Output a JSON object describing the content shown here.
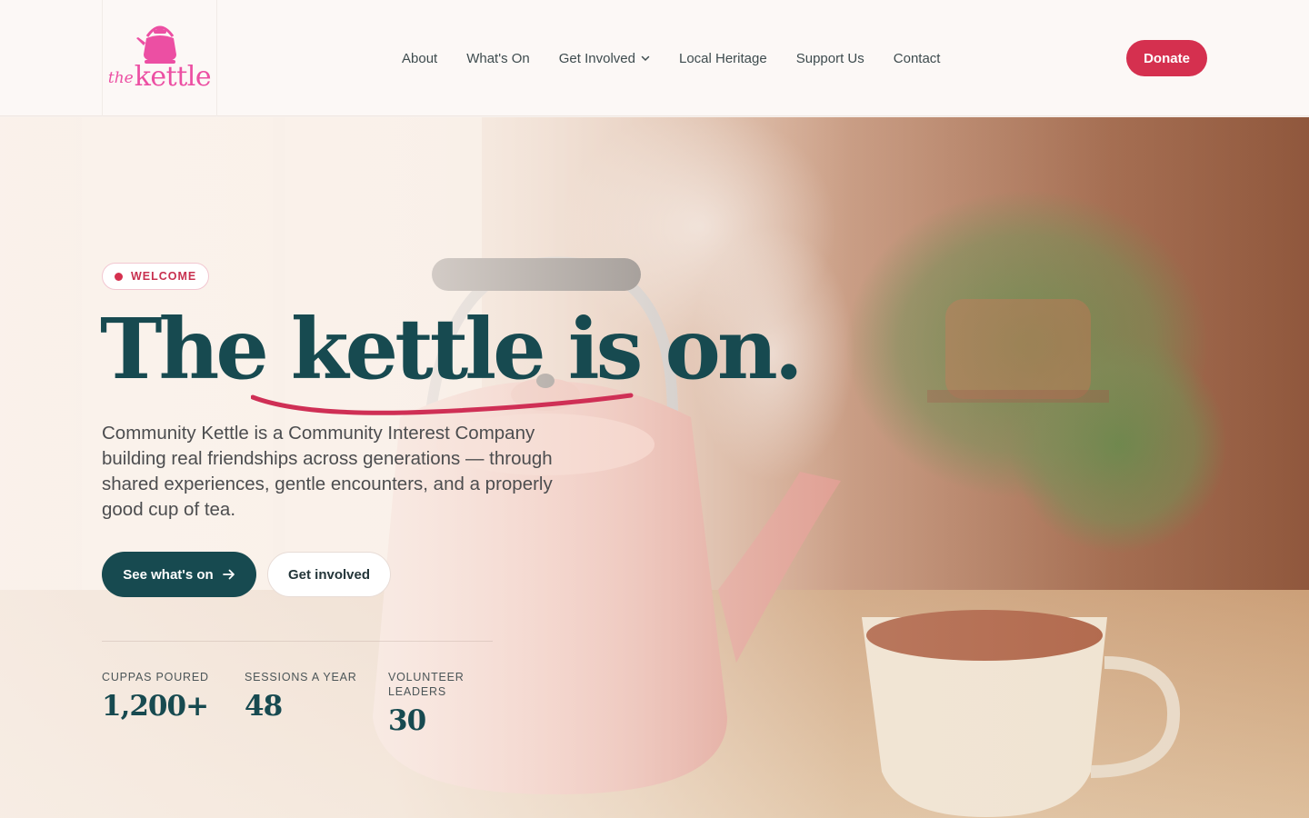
{
  "brand": {
    "logo_prefix": "the",
    "logo_word": "kettle",
    "color_primary": "#174a50",
    "color_accent": "#d5304f",
    "color_logo": "#ec4fa3"
  },
  "nav": {
    "items": [
      {
        "label": "About"
      },
      {
        "label": "What's On"
      },
      {
        "label": "Get Involved",
        "has_dropdown": true
      },
      {
        "label": "Local Heritage"
      },
      {
        "label": "Support Us"
      },
      {
        "label": "Contact"
      }
    ],
    "donate_label": "Donate"
  },
  "hero": {
    "badge": "WELCOME",
    "title_the": "The ",
    "title_rest": "kettle is on.",
    "description": "Community Kettle is a Community Interest Company building real friendships across generations — through shared experiences, gentle encounters, and a properly good cup of tea.",
    "primary_cta": "See what's on",
    "secondary_cta": "Get involved"
  },
  "stats": [
    {
      "label": "CUPPAS POURED",
      "value": "1,200+"
    },
    {
      "label": "SESSIONS A YEAR",
      "value": "48"
    },
    {
      "label": "VOLUNTEER LEADERS",
      "value": "30"
    }
  ]
}
